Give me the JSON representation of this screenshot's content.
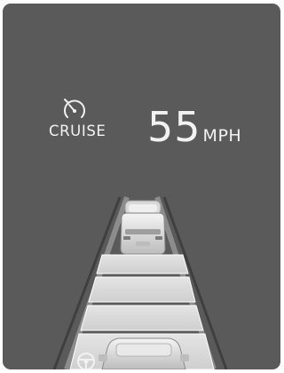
{
  "cruise": {
    "label": "CRUISE",
    "icon": "speedometer-icon"
  },
  "speed": {
    "value": "55",
    "unit": "MPH"
  },
  "road": {
    "lead_vehicle_icon": "lead-car-icon",
    "own_vehicle_icon": "own-car-icon",
    "steering_icon": "steering-wheel-icon",
    "following_distance_bars": 4
  },
  "colors": {
    "background": "#5a5a5a",
    "text": "#f2f2f2",
    "distance_bar": "#dcdcdc"
  }
}
